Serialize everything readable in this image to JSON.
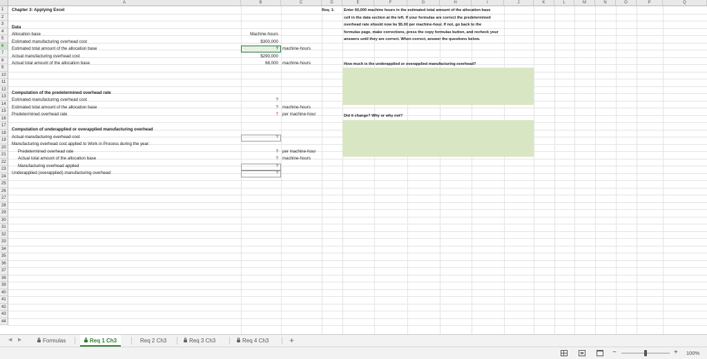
{
  "columns": [
    "A",
    "B",
    "C",
    "D",
    "E",
    "F",
    "G",
    "H",
    "I",
    "J",
    "K",
    "L",
    "M",
    "N",
    "O",
    "P",
    "Q"
  ],
  "rows": [
    "1",
    "2",
    "3",
    "4",
    "5",
    "6",
    "7",
    "8",
    "9",
    "10",
    "11",
    "12",
    "13",
    "14",
    "15",
    "16",
    "17",
    "18",
    "19",
    "20",
    "21",
    "22",
    "23",
    "24",
    "25",
    "26",
    "27",
    "28",
    "29",
    "30",
    "31",
    "32",
    "33",
    "34",
    "35",
    "36",
    "37",
    "38",
    "39",
    "40",
    "41",
    "42",
    "43",
    "44"
  ],
  "cells": {
    "a1": "Chapter 3: Applying Excel",
    "a3": "Data",
    "a4": "Allocation base",
    "b4": "Machine-hours",
    "a5": "Estimated manufacturing overhead cost",
    "b5": "$300,000",
    "a6": "Estimated total amount of the allocation base",
    "b6": "?",
    "c6": "machine-hours",
    "a7": "Actual manufacturing overhead cost",
    "b7": "$290,000",
    "a8": "Actual total amount of the allocation base",
    "b8": "68,000",
    "c8": "machine-hours",
    "a12": "Computation of the predetermined overhead rate",
    "a13": "Estimated manufacturing overhead cost",
    "b13": "?",
    "a14": "Estimated total amount of the allocation base",
    "b14": "?",
    "c14": "machine-hours",
    "a15": "Predetermined overhead rate",
    "b15": "?",
    "c15": "per machine-hour",
    "a17": "Computation of underapplied or overapplied manufacturing overhead",
    "a18": "Actual manufacturing overhead cost",
    "b18": "?",
    "a19": "Manufacturing overhead cost applied to Work in Process during the year:",
    "a20": "Predetermined overhead rate",
    "b20": "?",
    "c20": "per machine-hour",
    "a21": "Actual total amount of the allocation base",
    "b21": "?",
    "c21": "machine-hours",
    "a22": "Manufacturing overhead applied",
    "b22": "?",
    "a23": "Underapplied (overapplied) manufacturing overhead",
    "b23": "?"
  },
  "instructions": {
    "label": "Req. 1:",
    "lines": [
      "Enter 60,000 machine hours in the estimated total amount of the allocation base",
      "cell in the data section at the left.  If your formulas are correct the predetermined",
      "overhead rate should now be $5.00 per machine-hour.  If not, go back to the",
      "formulas page, make corrections, press the copy formulas button, and recheck your",
      "answers until they are correct.  When correct, answer the questions below."
    ],
    "question1": "How much is the underapplied or overapplied manufacturing overhead?",
    "question2": "Did it change?  Why or why not?"
  },
  "tabs": [
    {
      "label": "Formulas",
      "locked": true,
      "active": false
    },
    {
      "label": "Req 1 Ch3",
      "locked": true,
      "active": true
    },
    {
      "label": "Req 2 Ch3",
      "locked": false,
      "active": false
    },
    {
      "label": "Req 3 Ch3",
      "locked": true,
      "active": false
    },
    {
      "label": "Req 4 Ch3",
      "locked": true,
      "active": false
    }
  ],
  "add_sheet": "+",
  "zoom": {
    "minus": "−",
    "plus": "+",
    "level": "100%",
    "value": 1.0
  },
  "colors": {
    "answer_fill": "#d9e6c4",
    "active_tab": "#2e7d32",
    "placeholder_red": "#d0021b"
  }
}
